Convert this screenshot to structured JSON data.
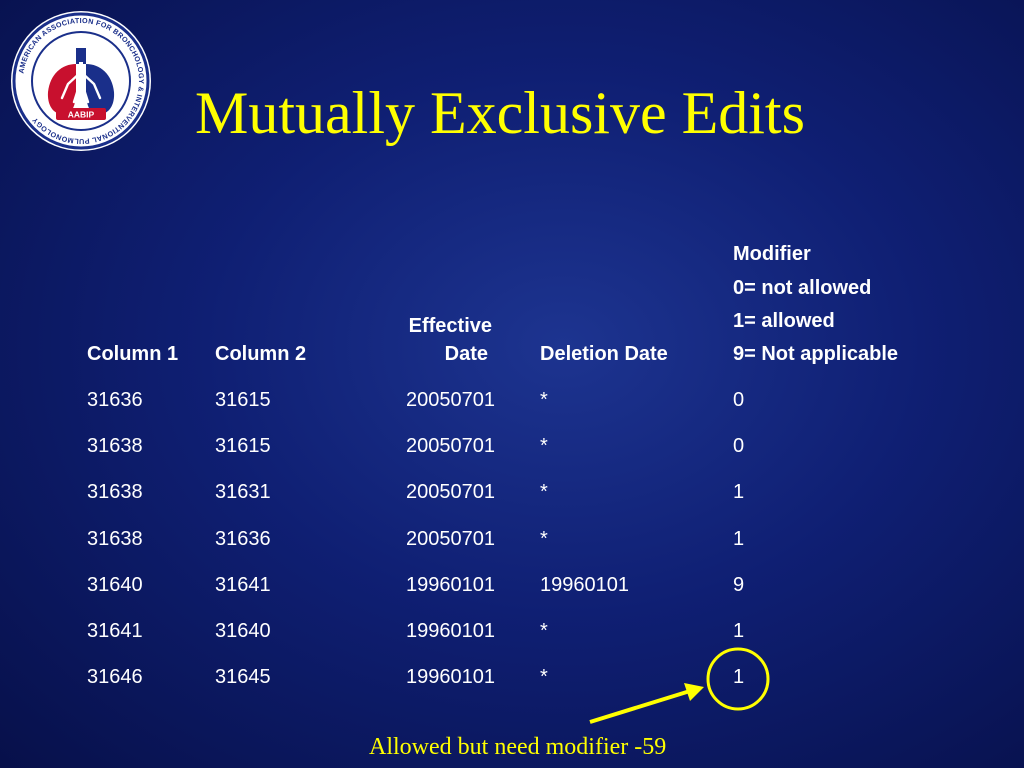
{
  "slide": {
    "title": "Mutually Exclusive Edits",
    "annotation": "Allowed but need modifier -59"
  },
  "logo": {
    "text": "AMERICAN ASSOCIATION FOR BRONCHOLOGY & INTERVENTIONAL PULMONOLOGY",
    "acronym": "AABIP"
  },
  "table": {
    "headers": {
      "col1": "Column 1",
      "col2": "Column 2",
      "effective_line1": "Effective",
      "effective_line2": "Date",
      "deletion": "Deletion Date",
      "modifier_line1": "Modifier",
      "modifier_line2": "0= not allowed",
      "modifier_line3": "1= allowed",
      "modifier_line4": "9= Not applicable"
    },
    "rows": [
      [
        "31636",
        "31615",
        "20050701",
        "*",
        "0"
      ],
      [
        "31638",
        "31615",
        "20050701",
        "*",
        "0"
      ],
      [
        "31638",
        "31631",
        "20050701",
        "*",
        "1"
      ],
      [
        "31638",
        "31636",
        "20050701",
        "*",
        "1"
      ],
      [
        "31640",
        "31641",
        "19960101",
        "19960101",
        "9"
      ],
      [
        "31641",
        "31640",
        "19960101",
        "*",
        "1"
      ],
      [
        "31646",
        "31645",
        "19960101",
        "*",
        "1"
      ]
    ]
  },
  "colors": {
    "title": "#ffff00",
    "text": "#ffffff",
    "background": "#0f1f73",
    "logo_red": "#c8102e",
    "logo_blue": "#1a2f8a"
  }
}
